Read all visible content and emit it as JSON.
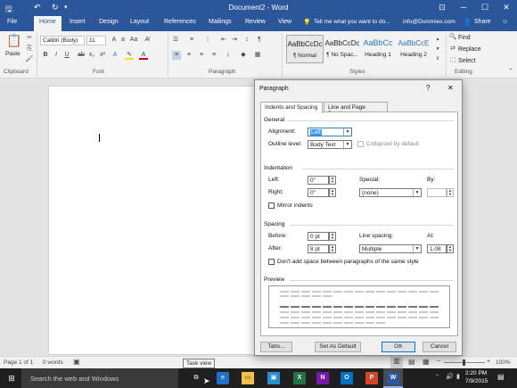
{
  "titlebar": {
    "title": "Document2 - Word",
    "restore_icon": "restore-icon",
    "minimize": "─",
    "maximize": "☐",
    "close": "✕"
  },
  "tabs": {
    "file": "File",
    "home": "Home",
    "insert": "Insert",
    "design": "Design",
    "layout": "Layout",
    "references": "References",
    "mailings": "Mailings",
    "review": "Review",
    "view": "View",
    "tell_me": "Tell me what you want to do...",
    "account": "info@Dummies.com",
    "share": "Share"
  },
  "ribbon": {
    "clipboard_label": "Clipboard",
    "paste_label": "Paste",
    "font_label": "Font",
    "paragraph_label": "Paragraph",
    "styles_label": "Styles",
    "editing_label": "Editing",
    "font_name": "Calibri (Body)",
    "font_size": "11",
    "find": "Find",
    "replace": "Replace",
    "select": "Select",
    "styles": [
      {
        "sample": "AaBbCcDc",
        "name": "¶ Normal"
      },
      {
        "sample": "AaBbCcDc",
        "name": "¶ No Spac..."
      },
      {
        "sample": "AaBbCc",
        "name": "Heading 1"
      },
      {
        "sample": "AaBbCcE",
        "name": "Heading 2"
      }
    ]
  },
  "dialog": {
    "title": "Paragraph",
    "help": "?",
    "close": "✕",
    "tab_indents": "Indents and Spacing",
    "tab_breaks": "Line and Page Breaks",
    "general": "General",
    "alignment_label": "Alignment:",
    "alignment_value": "Left",
    "outline_label": "Outline level:",
    "outline_value": "Body Text",
    "collapsed_label": "Collapsed by default",
    "indentation": "Indentation",
    "left_label": "Left:",
    "left_value": "0\"",
    "right_label": "Right:",
    "right_value": "0\"",
    "special_label": "Special:",
    "special_value": "(none)",
    "by_label": "By:",
    "mirror_label": "Mirror indents",
    "spacing": "Spacing",
    "before_label": "Before:",
    "before_value": "0 pt",
    "after_label": "After:",
    "after_value": "8 pt",
    "line_spacing_label": "Line spacing:",
    "line_spacing_value": "Multiple",
    "at_label": "At:",
    "at_value": "1.08",
    "dont_add_label": "Don't add space between paragraphs of the same style",
    "preview": "Preview",
    "tabs_button": "Tabs...",
    "default_button": "Set As Default",
    "ok_button": "OK",
    "cancel_button": "Cancel"
  },
  "status": {
    "page": "Page 1 of 1",
    "words": "0 words",
    "zoom": "100%"
  },
  "taskbar": {
    "search": "Search the web and Windows",
    "tooltip": "Task view",
    "time": "2:20 PM",
    "date": "7/9/2015"
  }
}
